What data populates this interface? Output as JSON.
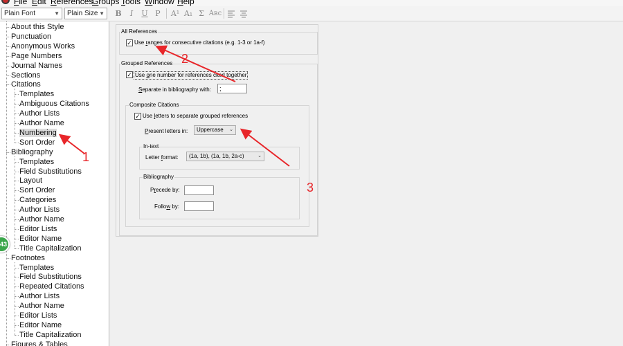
{
  "menubar": {
    "items": [
      {
        "key": "F",
        "rest": "ile"
      },
      {
        "key": "E",
        "rest": "dit"
      },
      {
        "key": "R",
        "rest": "eferences"
      },
      {
        "key": "G",
        "rest": "roups"
      },
      {
        "key": "T",
        "rest": "ools"
      },
      {
        "key": "W",
        "rest": "indow"
      },
      {
        "key": "H",
        "rest": "elp"
      }
    ]
  },
  "toolbar": {
    "font_value": "Plain Font",
    "size_value": "Plain Size",
    "buttons": [
      "B",
      "I",
      "U",
      "P",
      "A¹",
      "A₁",
      "Σ",
      "Aʙc"
    ]
  },
  "tree": {
    "items": [
      {
        "label": "About this Style",
        "level": 0
      },
      {
        "label": "Punctuation",
        "level": 0
      },
      {
        "label": "Anonymous Works",
        "level": 0
      },
      {
        "label": "Page Numbers",
        "level": 0
      },
      {
        "label": "Journal Names",
        "level": 0
      },
      {
        "label": "Sections",
        "level": 0
      },
      {
        "label": "Citations",
        "level": 0,
        "expanded": true
      },
      {
        "label": "Templates",
        "level": 1
      },
      {
        "label": "Ambiguous Citations",
        "level": 1
      },
      {
        "label": "Author Lists",
        "level": 1
      },
      {
        "label": "Author Name",
        "level": 1
      },
      {
        "label": "Numbering",
        "level": 1,
        "selected": true
      },
      {
        "label": "Sort Order",
        "level": 1
      },
      {
        "label": "Bibliography",
        "level": 0,
        "expanded": true
      },
      {
        "label": "Templates",
        "level": 1
      },
      {
        "label": "Field Substitutions",
        "level": 1
      },
      {
        "label": "Layout",
        "level": 1
      },
      {
        "label": "Sort Order",
        "level": 1
      },
      {
        "label": "Categories",
        "level": 1
      },
      {
        "label": "Author Lists",
        "level": 1
      },
      {
        "label": "Author Name",
        "level": 1
      },
      {
        "label": "Editor Lists",
        "level": 1
      },
      {
        "label": "Editor Name",
        "level": 1
      },
      {
        "label": "Title Capitalization",
        "level": 1
      },
      {
        "label": "Footnotes",
        "level": 0,
        "expanded": true
      },
      {
        "label": "Templates",
        "level": 1
      },
      {
        "label": "Field Substitutions",
        "level": 1
      },
      {
        "label": "Repeated Citations",
        "level": 1
      },
      {
        "label": "Author Lists",
        "level": 1
      },
      {
        "label": "Author Name",
        "level": 1
      },
      {
        "label": "Editor Lists",
        "level": 1
      },
      {
        "label": "Editor Name",
        "level": 1
      },
      {
        "label": "Title Capitalization",
        "level": 1
      },
      {
        "label": "Figures & Tables",
        "level": 0,
        "expanded": true
      }
    ],
    "badge_text": "43"
  },
  "numbering": {
    "all_references": {
      "legend": "All References",
      "use_ranges": {
        "checked": true,
        "pre": "Use ",
        "key": "r",
        "post": "anges for consecutive citations (e.g. 1-3 or 1a-f)"
      }
    },
    "grouped": {
      "legend": "Grouped References",
      "one_number": {
        "checked": true,
        "pre": "Use ",
        "key": "o",
        "post": "ne number for references cited together"
      },
      "separate_label": {
        "pre": "",
        "key": "S",
        "post": "eparate in bibliography with:"
      },
      "separate_value": ";",
      "composite": {
        "legend": "Composite Citations",
        "use_letters": {
          "checked": true,
          "pre": "Use ",
          "key": "l",
          "post": "etters to separate grouped references"
        },
        "present_label": {
          "pre": "",
          "key": "P",
          "post": "resent letters in:"
        },
        "present_value": "Uppercase",
        "intext": {
          "legend": "In-text",
          "letter_format_label": {
            "pre": "Letter ",
            "key": "f",
            "post": "ormat:"
          },
          "letter_format_value": "(1a, 1b), (1a, 1b, 2a-c)"
        },
        "bibliography": {
          "legend": "Bibliography",
          "precede_label": {
            "pre": "P",
            "key": "r",
            "post": "ecede by:"
          },
          "precede_value": "",
          "follow_label": {
            "pre": "Follo",
            "key": "w",
            "post": " by:"
          },
          "follow_value": ""
        }
      }
    }
  },
  "annotations": {
    "a1": "1",
    "a2": "2",
    "a3": "3",
    "color": "#e8262a"
  }
}
